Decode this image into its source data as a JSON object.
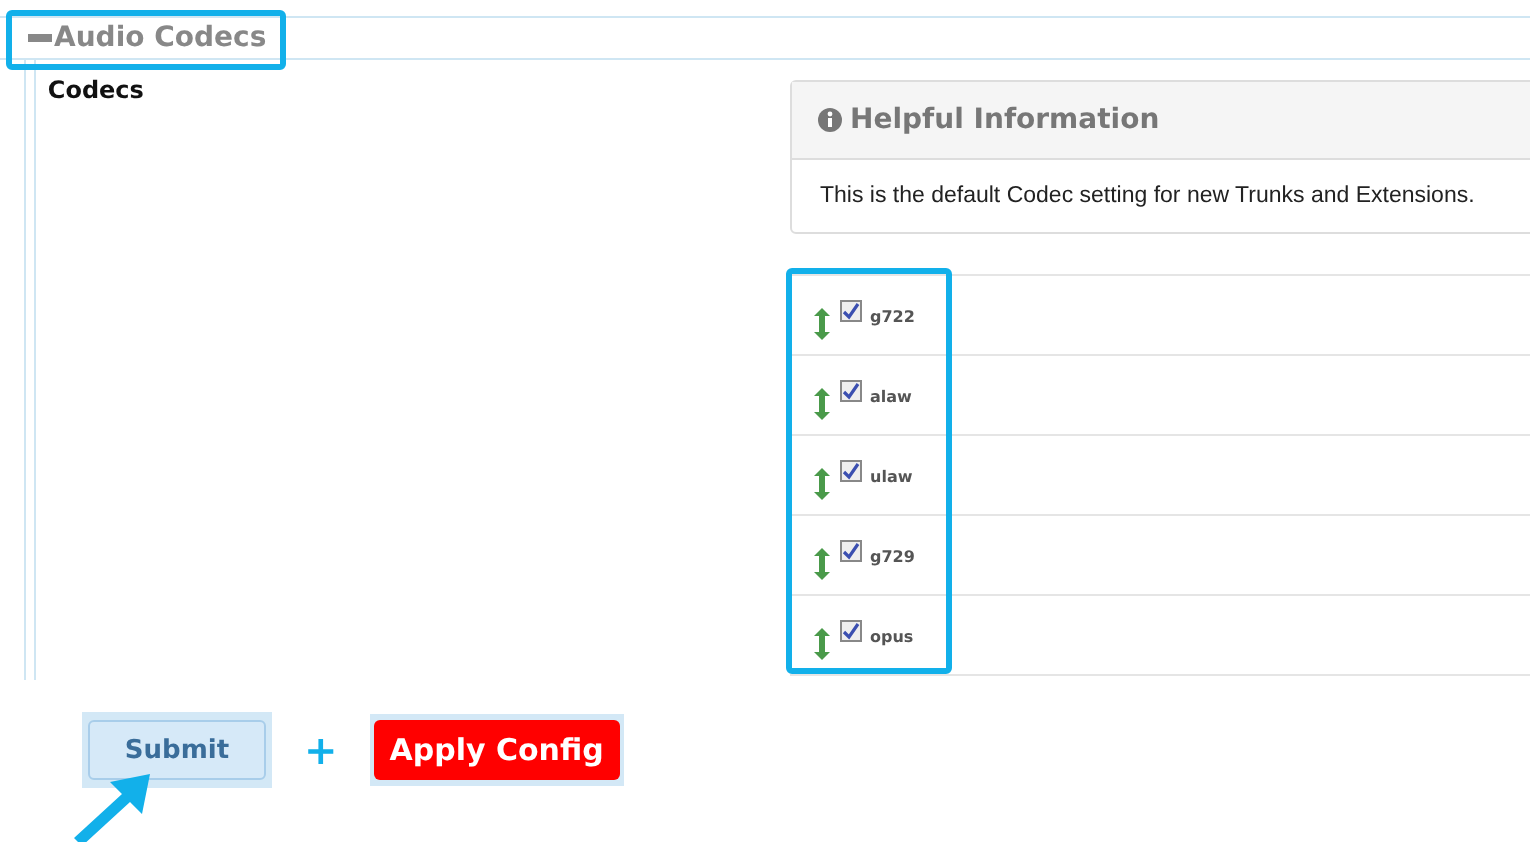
{
  "section": {
    "title": "Audio Codecs",
    "expanded": true
  },
  "field": {
    "label": "Codecs"
  },
  "help": {
    "title": "Helpful Information",
    "text": "This is the default Codec setting for new Trunks and Extensions."
  },
  "codecs": [
    {
      "name": "g722",
      "checked": true
    },
    {
      "name": "alaw",
      "checked": true
    },
    {
      "name": "ulaw",
      "checked": true
    },
    {
      "name": "g729",
      "checked": true
    },
    {
      "name": "opus",
      "checked": true
    }
  ],
  "actions": {
    "submit": "Submit",
    "joiner": "+",
    "apply": "Apply Config"
  }
}
